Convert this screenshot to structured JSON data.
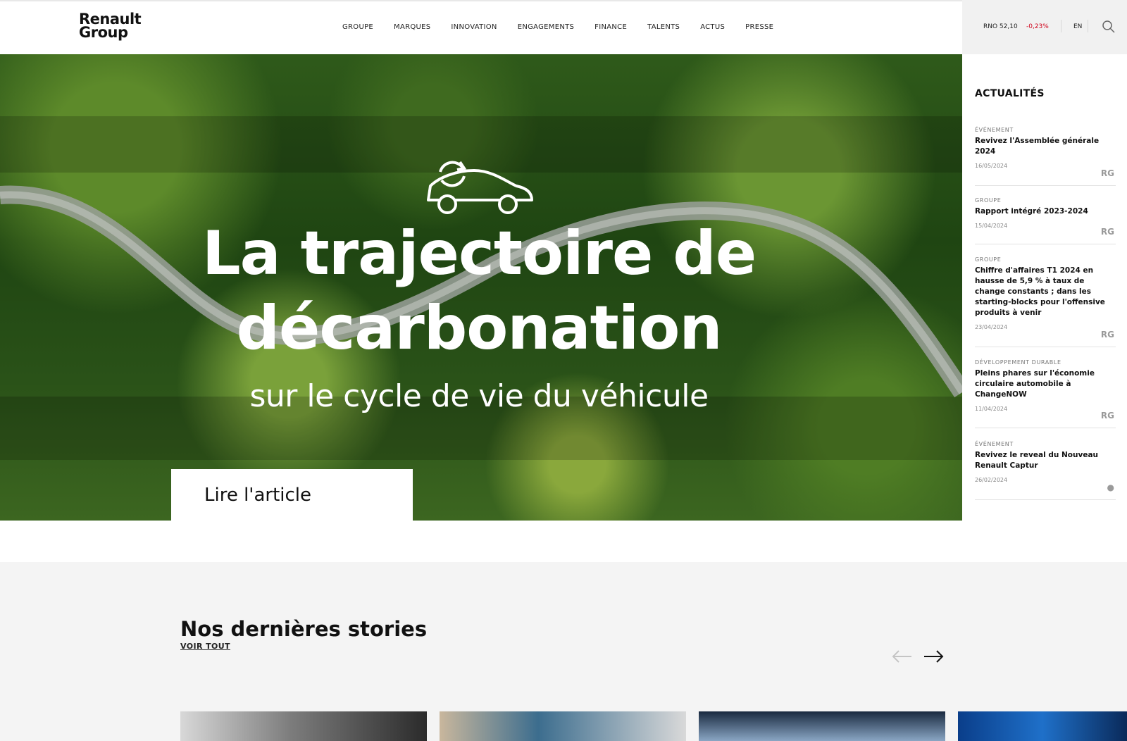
{
  "header": {
    "logo_line1": "Renault",
    "logo_line2": "Group",
    "nav": [
      "GROUPE",
      "MARQUES",
      "INNOVATION",
      "ENGAGEMENTS",
      "FINANCE",
      "TALENTS",
      "ACTUS",
      "PRESSE"
    ],
    "stock": "RNO 52,10",
    "stock_change": "-0,23%",
    "language": "EN",
    "search_icon": "search-icon"
  },
  "hero": {
    "title_line1": "La trajectoire de",
    "title_line2": "décarbonation",
    "subtitle": "sur le cycle de vie du véhicule",
    "cta": "Lire l'article",
    "icon": "car-recycle-icon"
  },
  "sidebar": {
    "heading": "ACTUALITÉS",
    "items": [
      {
        "category": "ÉVÉNEMENT",
        "title": "Revivez l'Assemblée générale 2024",
        "date": "16/05/2024",
        "mark": "RG"
      },
      {
        "category": "GROUPE",
        "title": "Rapport intégré 2023-2024",
        "date": "15/04/2024",
        "mark": "RG"
      },
      {
        "category": "GROUPE",
        "title": "Chiffre d'affaires T1 2024 en hausse de 5,9 % à taux de change constants ; dans les starting-blocks pour l'offensive produits à venir",
        "date": "23/04/2024",
        "mark": "RG"
      },
      {
        "category": "DÉVELOPPEMENT DURABLE",
        "title": "Pleins phares sur l'économie circulaire automobile à ChangeNOW",
        "date": "11/04/2024",
        "mark": "RG"
      },
      {
        "category": "ÉVÉNEMENT",
        "title": "Revivez le reveal du Nouveau Renault Captur",
        "date": "26/02/2024",
        "mark": "●"
      }
    ]
  },
  "stories": {
    "heading": "Nos dernières stories",
    "see_all": "VOIR TOUT",
    "prev_icon": "arrow-left-icon",
    "next_icon": "arrow-right-icon"
  }
}
